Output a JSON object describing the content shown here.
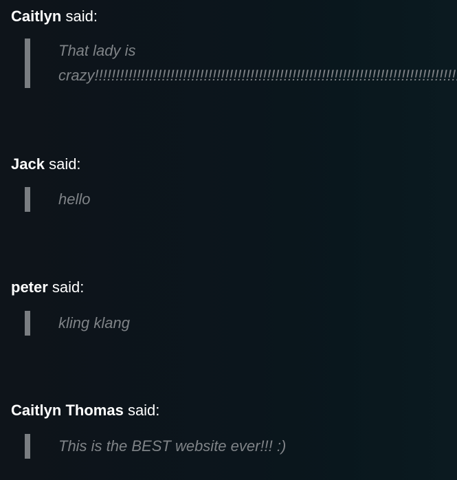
{
  "comments": [
    {
      "author": "Caitlyn",
      "said": "said:",
      "text_line1": "That lady is",
      "text_line2": "crazy!!!!!!!!!!!!!!!!!!!!!!!!!!!!!!!!!!!!!!!!!!!!!!!!!!!!!!!!!!!!!!!!!!!!!!!!!!!!!!!!!!!!!!!!!!!!!!!!!!!!!!!!"
    },
    {
      "author": "Jack",
      "said": "said:",
      "text": "hello"
    },
    {
      "author": "peter",
      "said": "said:",
      "text": "kling klang"
    },
    {
      "author": "Caitlyn Thomas",
      "said": "said:",
      "text": "This is the BEST website ever!!! :)"
    }
  ],
  "colors": {
    "background": "#0b151c",
    "author_text": "#ffffff",
    "quote_text": "#7f8387",
    "quote_bar": "#7a7e82"
  }
}
